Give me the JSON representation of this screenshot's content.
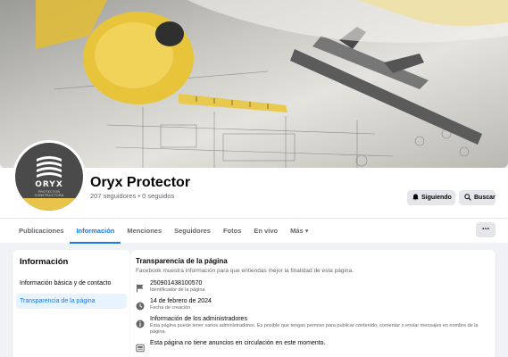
{
  "page": {
    "name": "Oryx Protector",
    "stats": "207 seguidores • 0 seguidos"
  },
  "logo": {
    "name": "ORYX",
    "sub1": "PROTECTOR",
    "sub2": "CONSTRUCTORA"
  },
  "actions": {
    "follow_label": "Siguiendo",
    "search_label": "Buscar",
    "more_label": "..."
  },
  "nav": {
    "tabs": [
      {
        "label": "Publicaciones"
      },
      {
        "label": "Información"
      },
      {
        "label": "Menciones"
      },
      {
        "label": "Seguidores"
      },
      {
        "label": "Fotos"
      },
      {
        "label": "En vivo"
      },
      {
        "label": "Más ▾"
      }
    ],
    "active_index": 1
  },
  "sidebar": {
    "title": "Información",
    "items": [
      {
        "label": "Información básica y de contacto"
      },
      {
        "label": "Transparencia de la página"
      }
    ],
    "active_index": 1
  },
  "main": {
    "title": "Transparencia de la página",
    "desc": "Facebook muestra información para que entiendas mejor la finalidad de esta página.",
    "rows": [
      {
        "icon": "flag-icon",
        "value": "250901438100570",
        "label": "Identificador de la página"
      },
      {
        "icon": "clock-icon",
        "value": "14 de febrero de 2024",
        "label": "Fecha de creación"
      },
      {
        "icon": "info-icon",
        "value": "Información de los administradores",
        "label": "Esta página puede tener varios administradores. Es posible que tengan permiso para publicar contenido, comentar o enviar mensajes en nombre de la página."
      },
      {
        "icon": "ad-icon",
        "value": "Esta página no tiene anuncios en circulación en este momento.",
        "label": ""
      }
    ]
  },
  "colors": {
    "accent": "#1877f2",
    "background": "#f0f2f5"
  }
}
